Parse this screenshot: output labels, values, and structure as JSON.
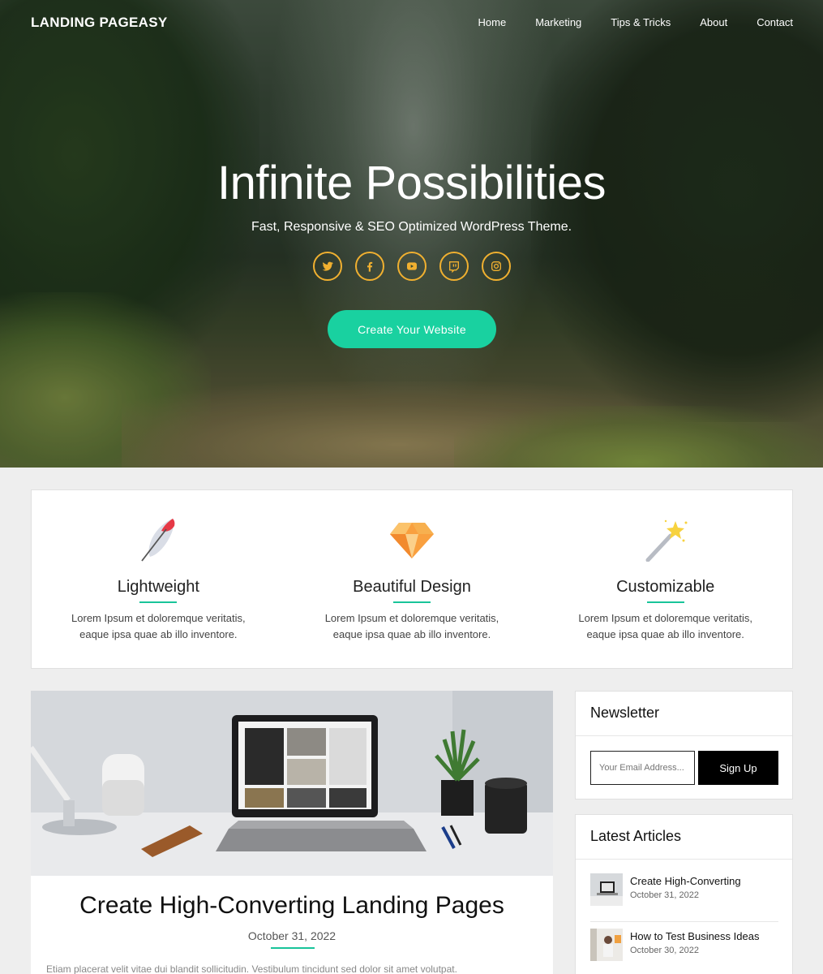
{
  "header": {
    "brand": "LANDING PAGEASY",
    "nav": [
      "Home",
      "Marketing",
      "Tips & Tricks",
      "About",
      "Contact"
    ]
  },
  "hero": {
    "title": "Infinite Possibilities",
    "subtitle": "Fast, Responsive & SEO Optimized WordPress Theme.",
    "socials": [
      "twitter-icon",
      "facebook-icon",
      "youtube-icon",
      "twitch-icon",
      "instagram-icon"
    ],
    "cta_label": "Create Your Website",
    "accent_color": "#19d1a0",
    "icon_ring_color": "#f0b030"
  },
  "features": [
    {
      "icon": "feather-icon",
      "title": "Lightweight",
      "text": "Lorem Ipsum et doloremque veritatis, eaque ipsa quae ab illo inventore."
    },
    {
      "icon": "diamond-icon",
      "title": "Beautiful Design",
      "text": "Lorem Ipsum et doloremque veritatis, eaque ipsa quae ab illo inventore."
    },
    {
      "icon": "magic-wand-icon",
      "title": "Customizable",
      "text": "Lorem Ipsum et doloremque veritatis, eaque ipsa quae ab illo inventore."
    }
  ],
  "post": {
    "title": "Create High-Converting Landing Pages",
    "date": "October 31, 2022",
    "excerpt": "Etiam placerat velit vitae dui blandit sollicitudin. Vestibulum tincidunt sed dolor sit amet volutpat."
  },
  "sidebar": {
    "newsletter": {
      "title": "Newsletter",
      "email_placeholder": "Your Email Address...",
      "signup_label": "Sign Up"
    },
    "latest": {
      "title": "Latest Articles",
      "articles": [
        {
          "title": "Create High-Converting",
          "date": "October 31, 2022"
        },
        {
          "title": "How to Test Business Ideas",
          "date": "October 30, 2022"
        }
      ]
    }
  }
}
